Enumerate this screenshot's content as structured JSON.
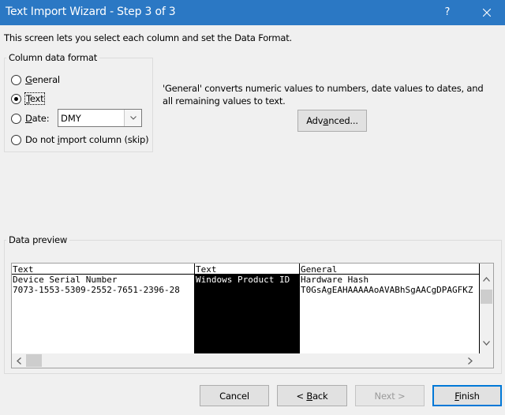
{
  "window": {
    "title": "Text Import Wizard - Step 3 of 3",
    "help_label": "?"
  },
  "intro": "This screen lets you select each column and set the Data Format.",
  "column_format": {
    "group_label": "Column data format",
    "options": {
      "general": "General",
      "text": "Text",
      "date": "Date:",
      "skip": "Do not import column (skip)"
    },
    "selected": "text",
    "date_format_value": "DMY"
  },
  "description": "'General' converts numeric values to numbers, date values to dates, and all remaining values to text.",
  "advanced_label": "Advanced...",
  "preview": {
    "group_label": "Data preview",
    "columns": [
      {
        "header": "Text",
        "rows": [
          "Device Serial Number",
          "7073-1553-5309-2552-7651-2396-28"
        ]
      },
      {
        "header": "Text",
        "rows": [
          "Windows Product ID",
          ""
        ]
      },
      {
        "header": "General",
        "rows": [
          "Hardware Hash",
          "T0GsAgEAHAAAAAoAVABhSgAACgDPAGFKZ"
        ]
      }
    ]
  },
  "buttons": {
    "cancel": "Cancel",
    "back": "< Back",
    "next": "Next >",
    "finish": "Finish"
  },
  "colors": {
    "titlebar": "#2b78c4",
    "default_button_border": "#0078d7",
    "selected_column_bg": "#000000"
  }
}
